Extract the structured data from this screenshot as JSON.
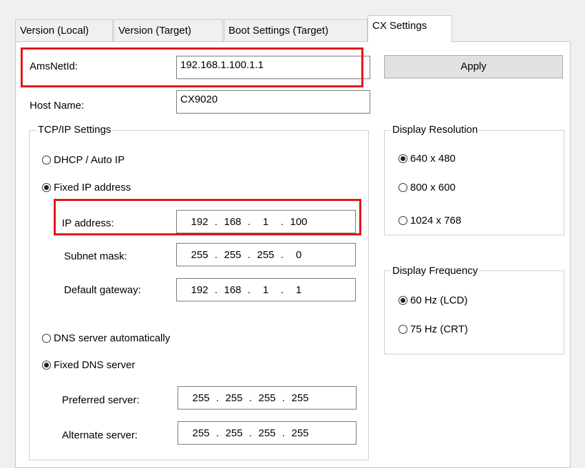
{
  "tabs": [
    {
      "label": "Version (Local)"
    },
    {
      "label": "Version (Target)"
    },
    {
      "label": "Boot Settings (Target)"
    },
    {
      "label": "CX Settings"
    }
  ],
  "ams_net_id": {
    "label": "AmsNetId:",
    "value": "192.168.1.100.1.1"
  },
  "host_name": {
    "label": "Host Name:",
    "value": "CX9020"
  },
  "apply_label": "Apply",
  "tcpip": {
    "title": "TCP/IP Settings",
    "dhcp_label": "DHCP / Auto IP",
    "fixed_ip_label": "Fixed IP address",
    "ip_address": {
      "label": "IP address:",
      "octets": [
        "192",
        "168",
        "1",
        "100"
      ]
    },
    "subnet_mask": {
      "label": "Subnet mask:",
      "octets": [
        "255",
        "255",
        "255",
        "0"
      ]
    },
    "default_gateway": {
      "label": "Default gateway:",
      "octets": [
        "192",
        "168",
        "1",
        "1"
      ]
    },
    "dns_auto_label": "DNS server automatically",
    "dns_fixed_label": "Fixed DNS server",
    "preferred_server": {
      "label": "Preferred server:",
      "octets": [
        "255",
        "255",
        "255",
        "255"
      ]
    },
    "alternate_server": {
      "label": "Alternate server:",
      "octets": [
        "255",
        "255",
        "255",
        "255"
      ]
    }
  },
  "display_resolution": {
    "title": "Display Resolution",
    "options": [
      "640 x 480",
      "800 x 600",
      "1024 x 768"
    ],
    "selected": "640 x 480"
  },
  "display_frequency": {
    "title": "Display Frequency",
    "options": [
      "60 Hz (LCD)",
      "75 Hz (CRT)"
    ],
    "selected": "60 Hz (LCD)"
  },
  "colors": {
    "highlight": "#e3121b",
    "background": "#f0f0f0",
    "panel": "#ffffff"
  }
}
